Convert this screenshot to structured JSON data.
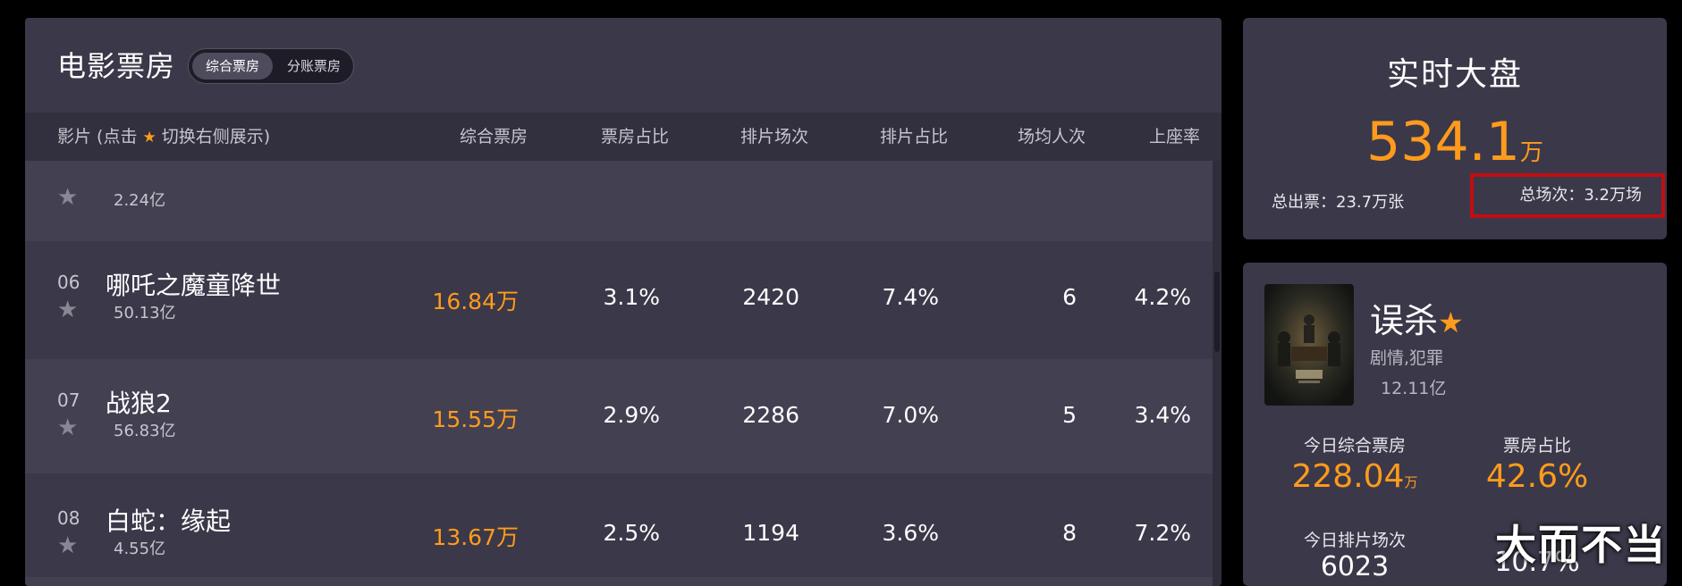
{
  "left_panel": {
    "title": "电影票房",
    "toggle": {
      "active": "综合票房",
      "other": "分账票房"
    },
    "columns": {
      "film_prefix": "影片 (点击 ",
      "film_suffix": " 切换右侧展示)",
      "box_office": "综合票房",
      "share": "票房占比",
      "shows": "排片场次",
      "show_share": "排片占比",
      "avg_audience": "场均人次",
      "occupancy": "上座率"
    },
    "partial_row": {
      "total": "2.24亿"
    },
    "rows": [
      {
        "rank": "06",
        "name": "哪吒之魔童降世",
        "total": "50.13亿",
        "box_office": "16.84万",
        "share": "3.1%",
        "shows": "2420",
        "show_share": "7.4%",
        "avg_audience": "6",
        "occupancy": "4.2%"
      },
      {
        "rank": "07",
        "name": "战狼2",
        "total": "56.83亿",
        "box_office": "15.55万",
        "share": "2.9%",
        "shows": "2286",
        "show_share": "7.0%",
        "avg_audience": "5",
        "occupancy": "3.4%"
      },
      {
        "rank": "08",
        "name": "白蛇：缘起",
        "total": "4.55亿",
        "box_office": "13.67万",
        "share": "2.5%",
        "shows": "1194",
        "show_share": "3.6%",
        "avg_audience": "8",
        "occupancy": "7.2%"
      }
    ]
  },
  "realtime": {
    "title": "实时大盘",
    "value": "534.1",
    "unit": "万",
    "tickets": "总出票：23.7万张",
    "shows": "总场次：3.2万场"
  },
  "movie_card": {
    "title": "误杀",
    "genre": "剧情,犯罪",
    "total": "12.11亿",
    "stats": {
      "today_box_label": "今日综合票房",
      "today_box_value": "228.04",
      "today_box_unit": "万",
      "share_label": "票房占比",
      "share_value": "42.6%",
      "shows_label": "今日排片场次",
      "shows_value": "6023",
      "show_share_value": "10.7%"
    }
  },
  "watermark": "大而不当",
  "colors": {
    "accent": "#ff9b1c",
    "panel": "#3b3849",
    "panel_alt": "#434052",
    "header": "#322f3f",
    "highlight_box": "#c10e12"
  }
}
